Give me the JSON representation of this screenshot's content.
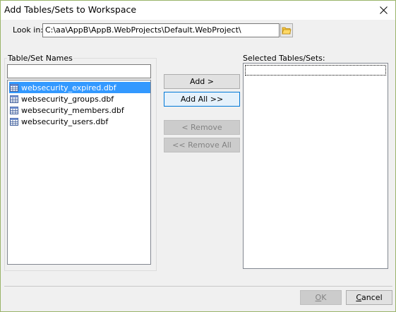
{
  "window": {
    "title": "Add Tables/Sets to Workspace"
  },
  "look_in": {
    "label": "Look in:",
    "path": "C:\\aa\\AppB\\AppB.WebProjects\\Default.WebProject\\"
  },
  "left_panel": {
    "label": "Table/Set Names",
    "filter_value": "",
    "items": [
      {
        "label": "websecurity_expired.dbf",
        "selected": true
      },
      {
        "label": "websecurity_groups.dbf",
        "selected": false
      },
      {
        "label": "websecurity_members.dbf",
        "selected": false
      },
      {
        "label": "websecurity_users.dbf",
        "selected": false
      }
    ]
  },
  "buttons": {
    "add": "Add >",
    "add_all": "Add All >>",
    "remove": "< Remove",
    "remove_all": "<< Remove All"
  },
  "right_panel": {
    "label": "Selected Tables/Sets:",
    "items": []
  },
  "footer": {
    "ok": "OK",
    "cancel": "Cancel"
  },
  "colors": {
    "selection": "#3399ff",
    "window_border": "#9ab46a",
    "default_button_border": "#0078d7"
  },
  "icons": {
    "close": "close-icon",
    "folder": "folder-open-icon",
    "table": "table-icon"
  }
}
